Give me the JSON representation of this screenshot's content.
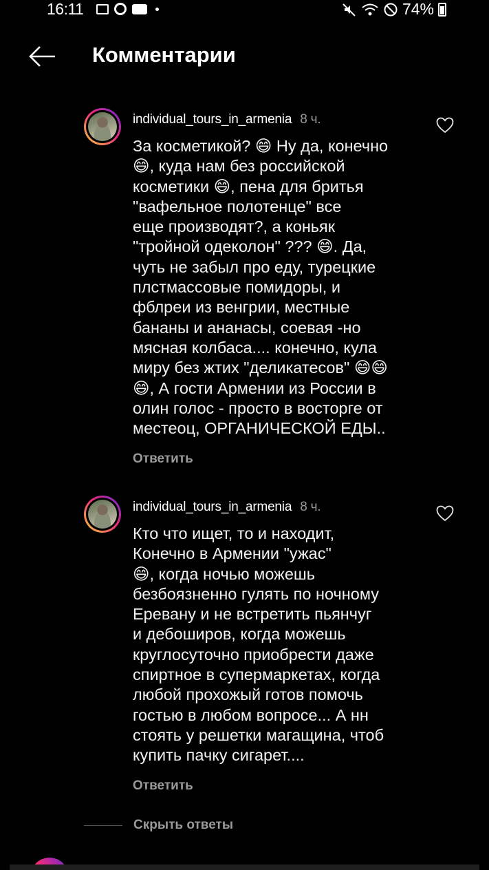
{
  "status_bar": {
    "time": "16:11",
    "battery": "74%"
  },
  "header": {
    "title": "Комментарии"
  },
  "comments": [
    {
      "username": "individual_tours_in_armenia",
      "time": "8 ч.",
      "text": "За косметикой? 😄 Ну да, конечно\n😄, куда нам без российской\nкосметики 😄, пена для бритья\n\"вафельное полотенце\" все\nеще производят?, а коньяк\n\"тройной одеколон\" ??? 😄. Да,\nчуть не забыл про еду, турецкие\nплстмассовые помидоры, и\nфблреи из венгрии, местные\nбананы и ананасы, соевая -но\nмясная колбаса.... конечно, кула\nмиру без жтих \"деликатесов\" 😄😄\n😄, А гости Армении из России в\nолин голос - просто в восторге от\nместеоц, ОРГАНИЧЕСКОЙ ЕДЫ..",
      "reply_label": "Ответить"
    },
    {
      "username": "individual_tours_in_armenia",
      "time": "8 ч.",
      "text": "Кто что ищет, то и находит,\nКонечно в Армении \"ужас\"\n😄, когда ночью можешь\nбезбоязненно гулять по ночному\nЕревану и не встретить пьянчуг\nи дебоширов, когда можешь\nкруглосуточно приобрести даже\nспиртное в супермаркетах, когда\nлюбой прохожый готов помочь\nгостью в любом вопросе... А нн\nстоять у решетки магащина, чтоб\nкупить пачку сигарет....",
      "reply_label": "Ответить"
    }
  ],
  "hide_replies_label": "Скрыть ответы",
  "icons": {
    "back": "arrow-left-icon",
    "like": "heart-outline-icon"
  },
  "colors": {
    "background": "#000000",
    "text": "#f2f2f2",
    "muted": "#9a9a9a"
  }
}
